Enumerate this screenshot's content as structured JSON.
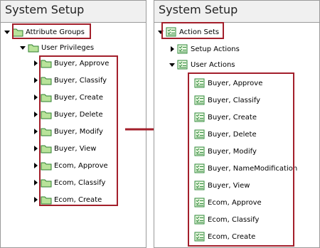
{
  "left_panel": {
    "title": "System Setup",
    "root": {
      "label": "Attribute Groups",
      "icon": "folder-icon"
    },
    "group": {
      "label": "User Privileges",
      "icon": "folder-icon"
    },
    "items": [
      "Buyer, Approve",
      "Buyer, Classify",
      "Buyer, Create",
      "Buyer, Delete",
      "Buyer, Modify",
      "Buyer, View",
      "Ecom, Approve",
      "Ecom, Classify",
      "Ecom, Create"
    ]
  },
  "right_panel": {
    "title": "System Setup",
    "root": {
      "label": "Action Sets",
      "icon": "action-set-icon"
    },
    "setup": {
      "label": "Setup Actions",
      "icon": "action-set-icon"
    },
    "user": {
      "label": "User Actions",
      "icon": "action-set-icon"
    },
    "items": [
      "Buyer, Approve",
      "Buyer, Classify",
      "Buyer, Create",
      "Buyer, Delete",
      "Buyer, Modify",
      "Buyer, NameModification",
      "Buyer, View",
      "Ecom, Approve",
      "Ecom, Classify",
      "Ecom, Create"
    ]
  },
  "colors": {
    "highlight": "#a31f2b",
    "folder": "#b9e39a",
    "action_icon": "#3aa64a"
  }
}
